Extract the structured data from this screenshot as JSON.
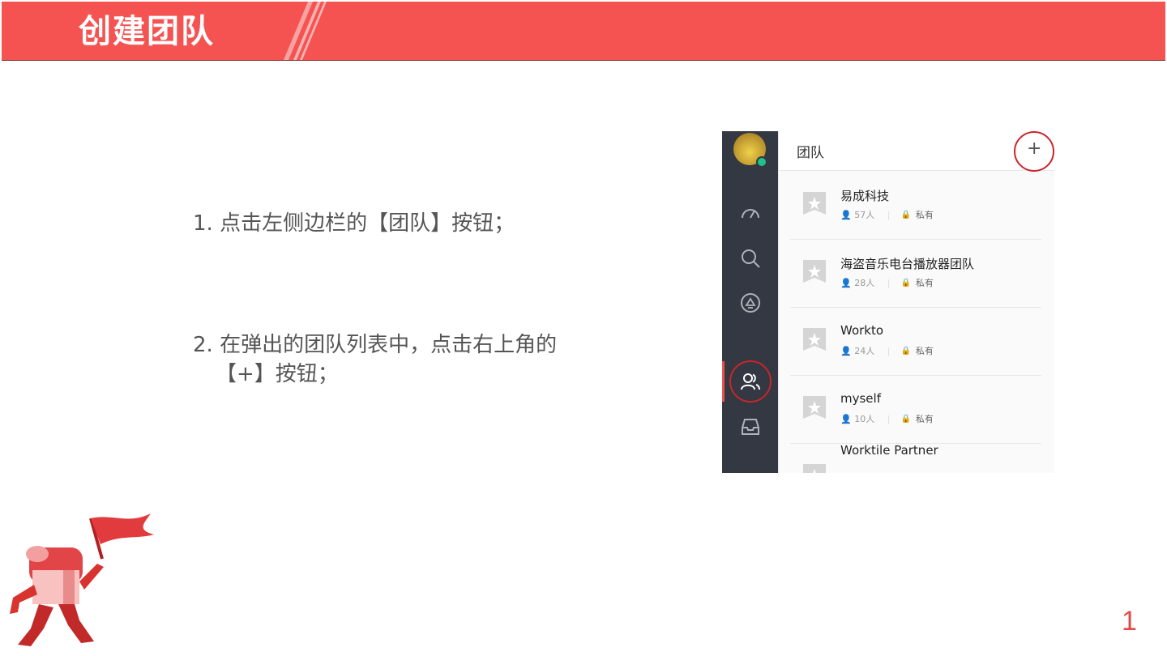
{
  "slide": {
    "title": "创建团队",
    "page_number": "1",
    "steps": [
      "1. 点击左侧边栏的【团队】按钮；",
      "2. 在弹出的团队列表中，点击右上角的",
      "【+】按钮；"
    ]
  },
  "screenshot": {
    "rail_icons": [
      "avatar",
      "dashboard-icon",
      "search-icon",
      "notification-icon",
      "team-icon",
      "inbox-icon"
    ],
    "panel_title": "团队",
    "add_button": "+",
    "teams": [
      {
        "name": "易成科技",
        "members": "57人",
        "privacy": "私有"
      },
      {
        "name": "海盗音乐电台播放器团队",
        "members": "28人",
        "privacy": "私有"
      },
      {
        "name": "Workto",
        "members": "24人",
        "privacy": "私有"
      },
      {
        "name": "myself",
        "members": "10人",
        "privacy": "私有"
      },
      {
        "name": "Worktile Partner",
        "members": "",
        "privacy": ""
      }
    ]
  },
  "colors": {
    "banner": "#f55352",
    "rail": "#333842",
    "highlight_circle": "#c8262b",
    "page_number": "#e04b49"
  }
}
